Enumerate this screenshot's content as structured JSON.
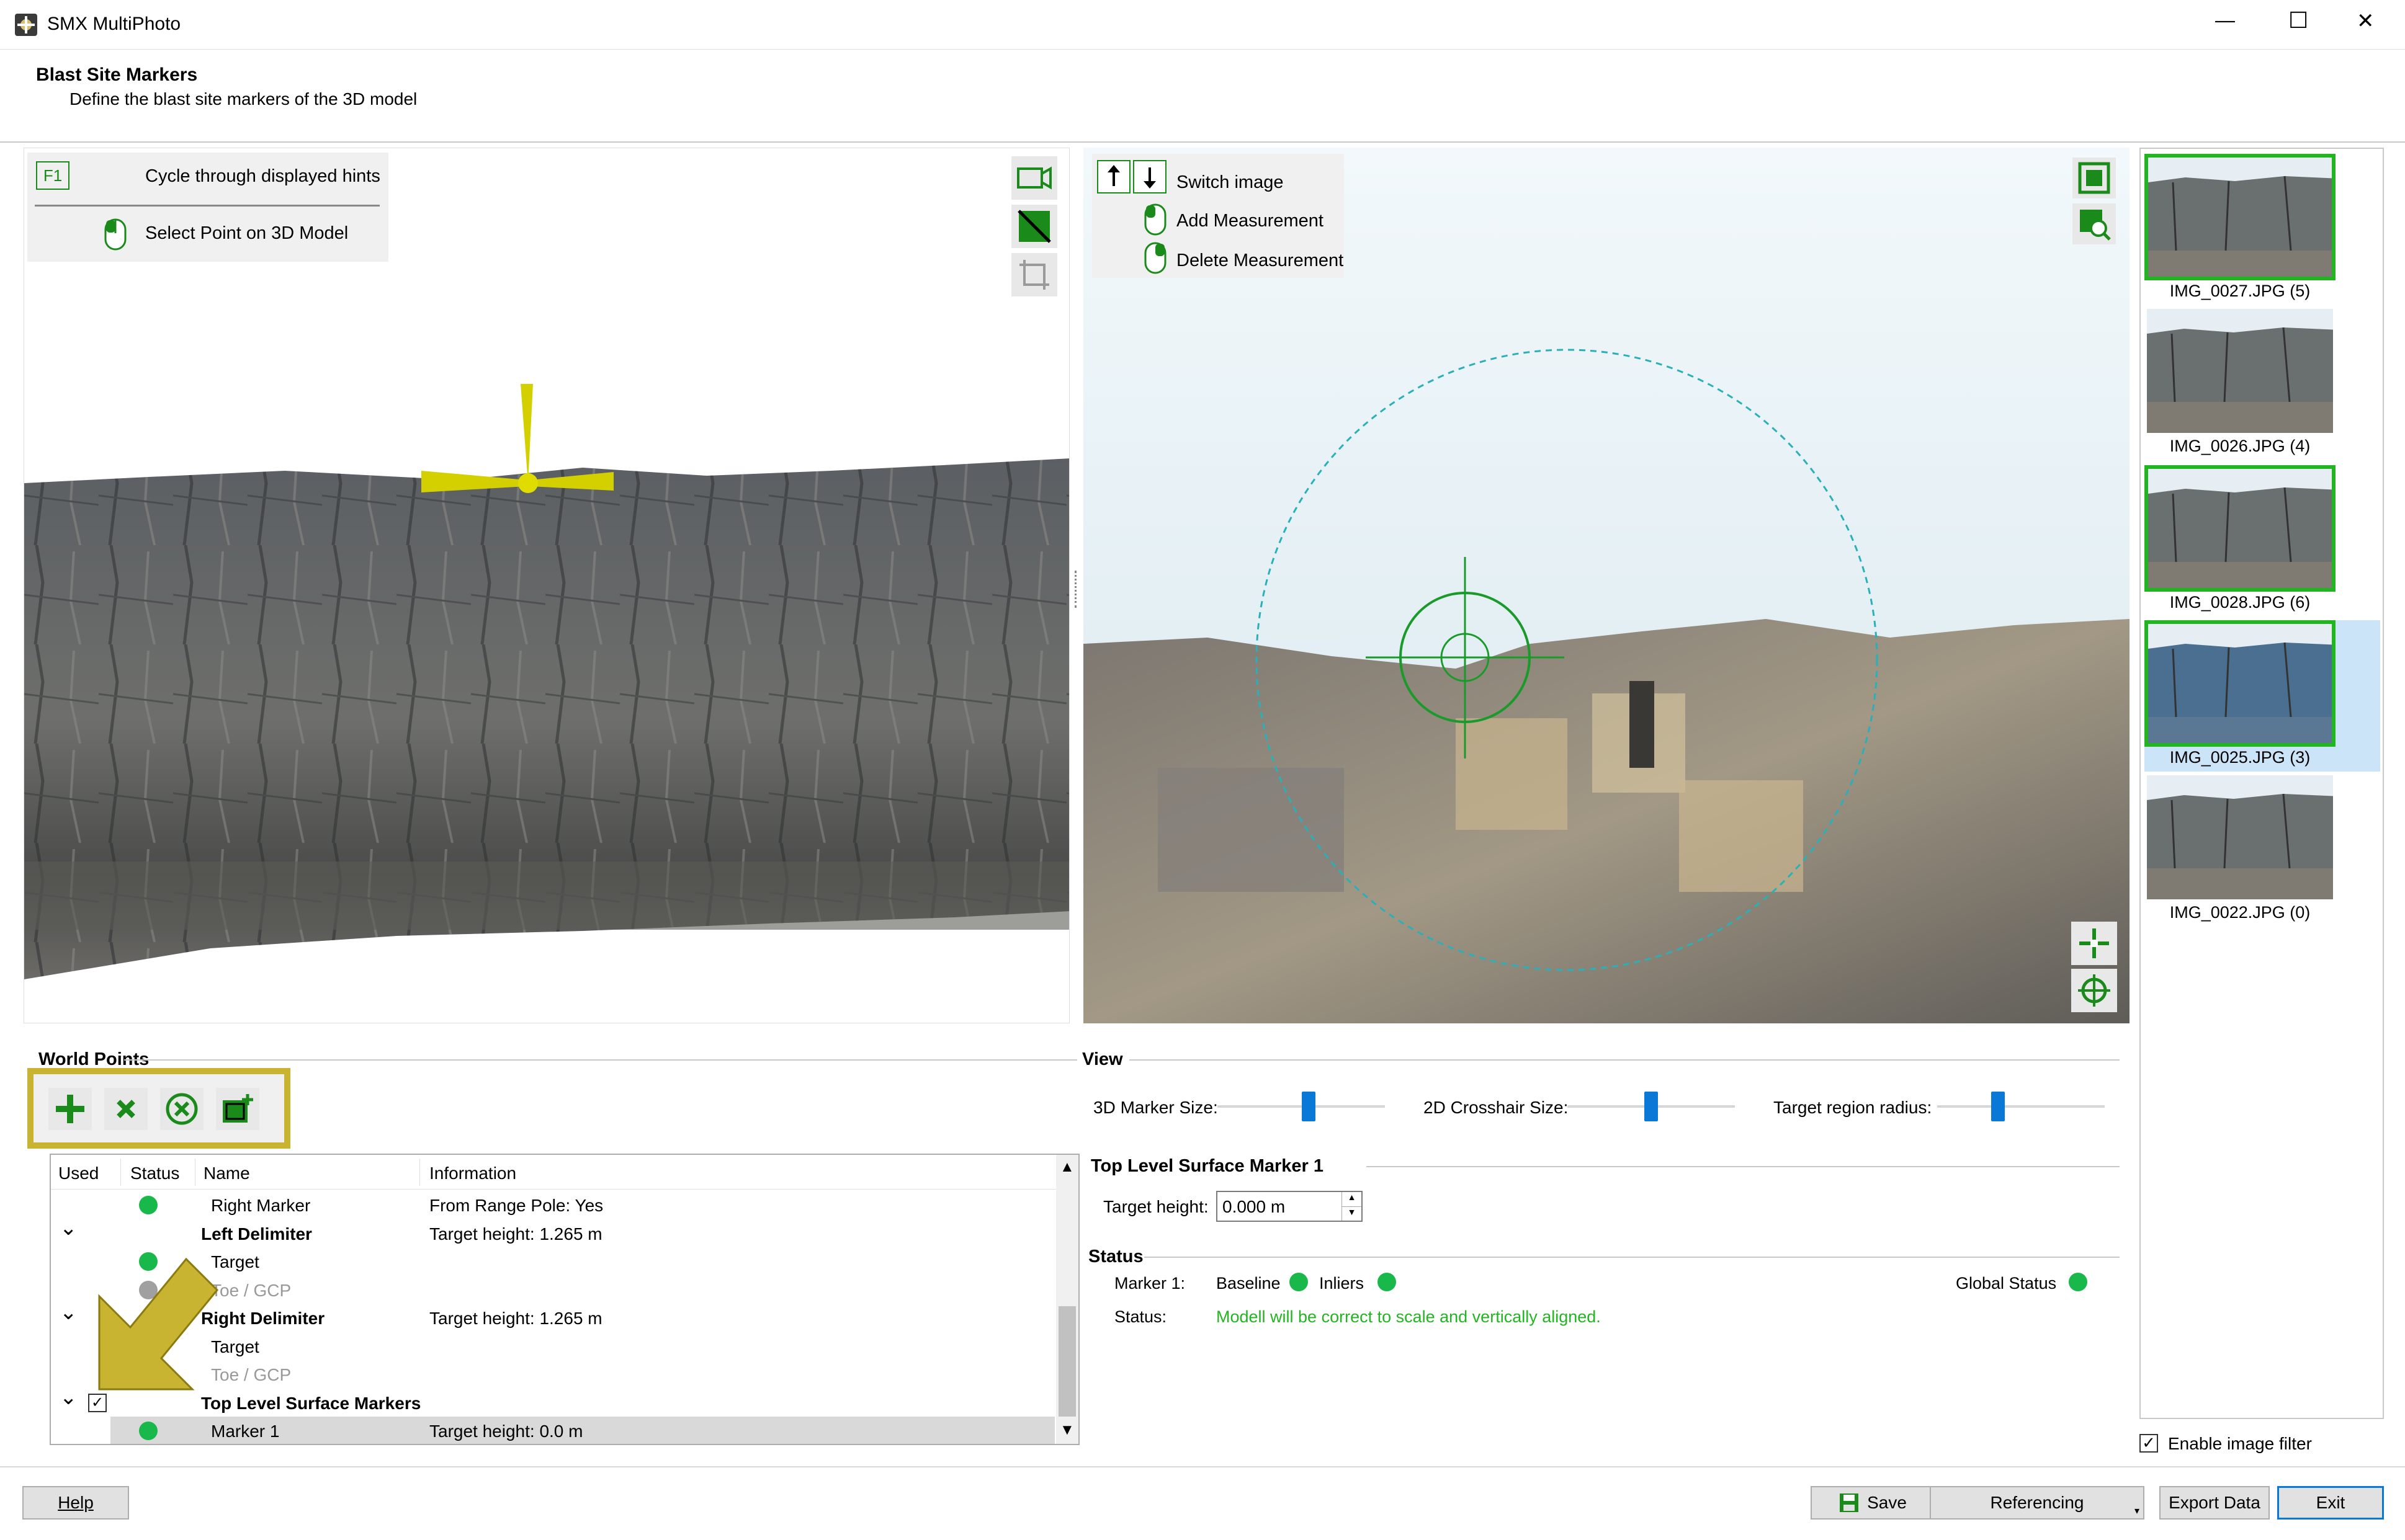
{
  "window": {
    "title": "SMX MultiPhoto",
    "minimize": "—",
    "maximize": "☐",
    "close": "✕"
  },
  "header": {
    "title": "Blast Site Markers",
    "subtitle": "Define the blast site markers of the 3D model"
  },
  "hints_left": {
    "key": "F1",
    "cycle": "Cycle through displayed hints",
    "select": "Select Point on 3D Model"
  },
  "hints_right": {
    "switch": "Switch image",
    "add": "Add Measurement",
    "delete": "Delete Measurement"
  },
  "world_points": {
    "title": "World Points",
    "columns": [
      "Used",
      "Status",
      "Name",
      "Information"
    ],
    "rows": [
      {
        "name": "Right Marker",
        "info": "From Range Pole: Yes",
        "status": "green"
      },
      {
        "name": "Left Delimiter",
        "info": "Target height: 1.265 m",
        "bold": true
      },
      {
        "name": "Target",
        "info": "",
        "status": "green"
      },
      {
        "name": "Toe / GCP",
        "info": "",
        "status": "gray"
      },
      {
        "name": "Right Delimiter",
        "info": "Target height: 1.265 m",
        "bold": true
      },
      {
        "name": "Target",
        "info": ""
      },
      {
        "name": "Toe / GCP",
        "info": ""
      },
      {
        "name": "Top Level Surface Markers",
        "info": "",
        "bold": true
      },
      {
        "name": "Marker 1",
        "info": "Target height: 0.0 m",
        "status": "green"
      }
    ]
  },
  "view": {
    "title": "View",
    "marker_size": "3D Marker Size:",
    "crosshair_size": "2D Crosshair Size:",
    "target_radius": "Target region radius:",
    "marker_level": 0.55,
    "crosshair_level": 0.5,
    "radius_level": 0.35
  },
  "marker_panel": {
    "title": "Top Level Surface Marker 1",
    "height_label": "Target height:",
    "height_value": "0.000 m"
  },
  "status": {
    "title": "Status",
    "marker_label": "Marker 1:",
    "baseline": "Baseline",
    "inliers": "Inliers",
    "global": "Global Status",
    "status_label": "Status:",
    "status_text": "Modell will be correct to scale and vertically aligned.",
    "status_color": "#22b521"
  },
  "images": [
    {
      "label": "IMG_0027.JPG (5)",
      "selected": true
    },
    {
      "label": "IMG_0026.JPG (4)",
      "selected": false
    },
    {
      "label": "IMG_0028.JPG (6)",
      "selected": true
    },
    {
      "label": "IMG_0025.JPG (3)",
      "selected": true,
      "active": true
    },
    {
      "label": "IMG_0022.JPG (0)",
      "selected": false
    }
  ],
  "filter": {
    "label": "Enable image filter",
    "checked": true
  },
  "footer": {
    "help": "Help",
    "save": "Save",
    "referencing": "Referencing",
    "export": "Export Data",
    "exit": "Exit"
  },
  "colors": {
    "accent_green": "#1a8a1a",
    "highlight_yellow": "#c8b431",
    "status_green": "#19b84b"
  }
}
